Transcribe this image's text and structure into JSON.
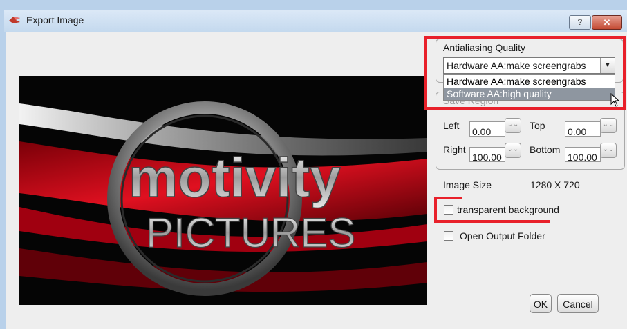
{
  "window": {
    "title": "Export Image",
    "help_label": "?",
    "close_label": "✕"
  },
  "preview": {
    "logo_line1": "motivity",
    "logo_line2": "PICTURES"
  },
  "antialiasing": {
    "group_label": "Antialiasing Quality",
    "selected": "Hardware AA:make screengrabs",
    "options": [
      "Hardware AA:make screengrabs",
      "Software AA:high quality"
    ],
    "highlighted_index": 1
  },
  "save_region": {
    "group_label": "Save Region",
    "left_label": "Left",
    "left_value": "0.00",
    "top_label": "Top",
    "top_value": "0.00",
    "right_label": "Right",
    "right_value": "100.00",
    "bottom_label": "Bottom",
    "bottom_value": "100.00"
  },
  "image_size": {
    "label": "Image Size",
    "value": "1280 X 720"
  },
  "options": {
    "transparent_label": "transparent background",
    "transparent_checked": false,
    "open_folder_label": "Open Output Folder",
    "open_folder_checked": false
  },
  "buttons": {
    "ok": "OK",
    "cancel": "Cancel"
  },
  "colors": {
    "highlight": "#e8202a",
    "selection": "#8e96a0"
  }
}
